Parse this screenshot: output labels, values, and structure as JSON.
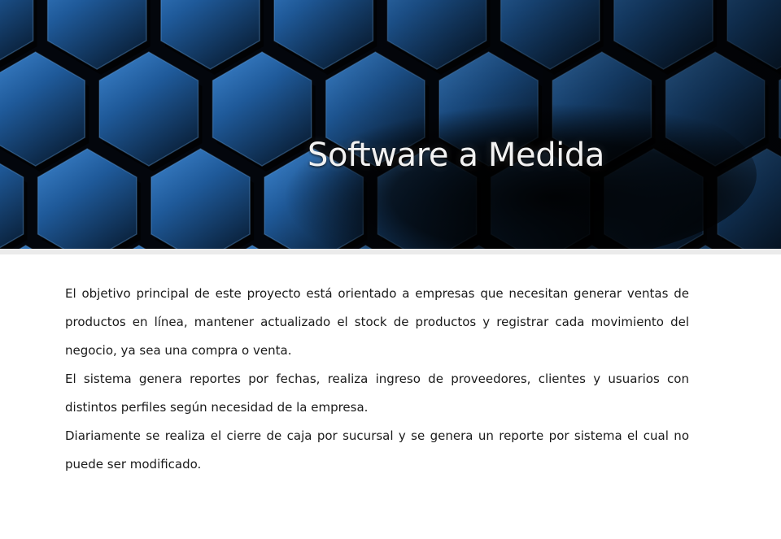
{
  "banner": {
    "title": "Software a Medida",
    "colors": {
      "background": "#03060c",
      "hex_fill": "#1f5a9a",
      "hex_highlight": "#3f86cf",
      "title_text": "#f2f2f2"
    }
  },
  "content": {
    "paragraphs": [
      "El objetivo principal de este proyecto está orientado a empresas que necesitan generar ventas de productos en línea, mantener actualizado el stock de productos y registrar cada movimiento del negocio, ya sea una compra o venta.",
      "El sistema genera reportes por fechas, realiza ingreso de proveedores, clientes y usuarios con distintos perfiles según necesidad de la empresa.",
      "Diariamente se realiza el cierre de caja por sucursal y se genera un reporte por sistema el cual no puede ser modificado."
    ]
  }
}
